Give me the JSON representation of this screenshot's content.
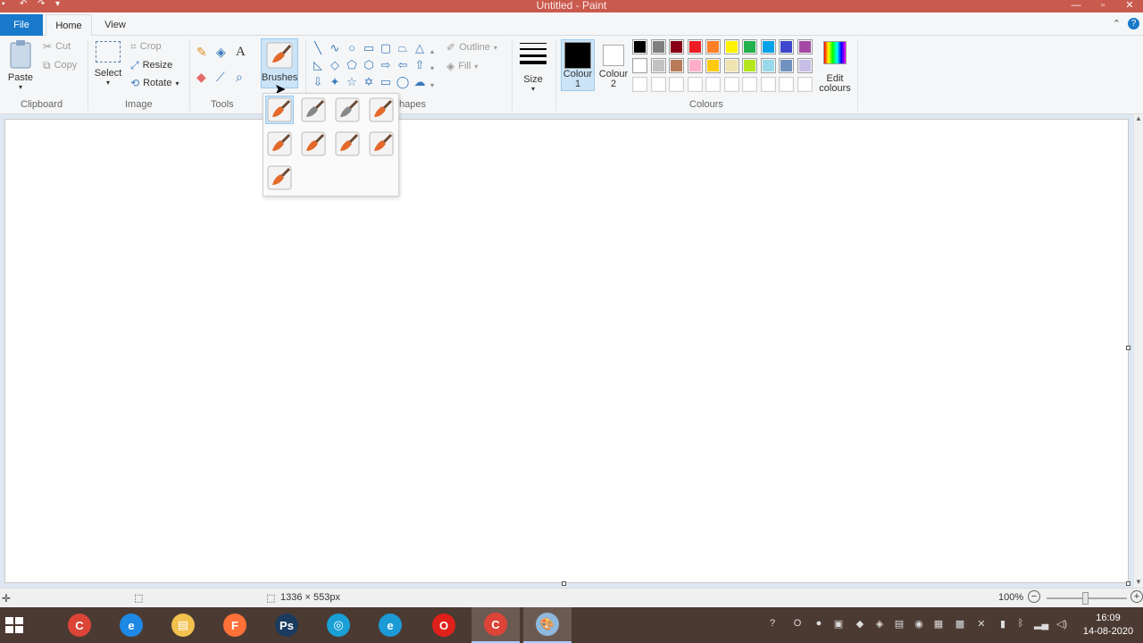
{
  "window": {
    "title": "Untitled - Paint",
    "qat": [
      "save-icon",
      "undo-icon",
      "redo-icon",
      "chevron-down-icon"
    ],
    "controls": [
      "minimize-icon",
      "maximize-icon",
      "close-icon"
    ]
  },
  "tabs": [
    {
      "label": "File"
    },
    {
      "label": "Home"
    },
    {
      "label": "View"
    }
  ],
  "ribbon": {
    "clipboard": {
      "paste": "Paste",
      "cut": "Cut",
      "copy": "Copy",
      "label": "Clipboard"
    },
    "image": {
      "select": "Select",
      "crop": "Crop",
      "resize": "Resize",
      "rotate": "Rotate",
      "label": "Image"
    },
    "tools": {
      "label": "Tools",
      "text_tool": "A"
    },
    "brushes": {
      "label": "Brushes"
    },
    "shapes": {
      "outline": "Outline",
      "fill": "Fill",
      "label": "Shapes",
      "label_visible": "hapes"
    },
    "size": {
      "label": "Size"
    },
    "colour1": {
      "line1": "Colour",
      "line2": "1",
      "color": "#000000"
    },
    "colour2": {
      "line1": "Colour",
      "line2": "2",
      "color": "#ffffff"
    },
    "edit_colours": {
      "line1": "Edit",
      "line2": "colours"
    },
    "colours_label": "Colours",
    "palette_row1": [
      "#000000",
      "#7f7f7f",
      "#880015",
      "#ed1c24",
      "#ff7f27",
      "#fff200",
      "#22b14c",
      "#00a2e8",
      "#3f48cc",
      "#a349a4"
    ],
    "palette_row2": [
      "#ffffff",
      "#c3c3c3",
      "#b97a57",
      "#ffaec9",
      "#ffc90e",
      "#efe4b0",
      "#b5e61d",
      "#99d9ea",
      "#7092be",
      "#c8bfe7"
    ],
    "palette_row3": [
      "#ffffff",
      "#ffffff",
      "#ffffff",
      "#ffffff",
      "#ffffff",
      "#ffffff",
      "#ffffff",
      "#ffffff",
      "#ffffff",
      "#ffffff"
    ]
  },
  "brush_menu": {
    "items": [
      "Brush",
      "Calligraphy brush 1",
      "Calligraphy brush 2",
      "Airbrush",
      "Oil brush",
      "Crayon",
      "Marker",
      "Natural pencil",
      "Watercolour brush"
    ],
    "selected_index": 0
  },
  "status": {
    "image_size": "1336 × 553px",
    "zoom": "100%"
  },
  "taskbar": {
    "apps": [
      {
        "name": "chrome",
        "glyph": "C",
        "color": "#db4437"
      },
      {
        "name": "internet-explorer",
        "glyph": "e",
        "color": "#1e88e5"
      },
      {
        "name": "file-explorer",
        "glyph": "▤",
        "color": "#f2c14e"
      },
      {
        "name": "firefox",
        "glyph": "F",
        "color": "#ff7139"
      },
      {
        "name": "photoshop",
        "glyph": "Ps",
        "color": "#1b3b5f"
      },
      {
        "name": "search-app",
        "glyph": "◎",
        "color": "#1a9fd6"
      },
      {
        "name": "edge",
        "glyph": "e",
        "color": "#1c9ad6"
      },
      {
        "name": "opera",
        "glyph": "O",
        "color": "#e0201b"
      },
      {
        "name": "chrome-2",
        "glyph": "C",
        "color": "#db4437"
      },
      {
        "name": "paint",
        "glyph": "🎨",
        "color": "#8fb8de"
      }
    ],
    "time": "16:09",
    "date": "14-08-2020"
  }
}
